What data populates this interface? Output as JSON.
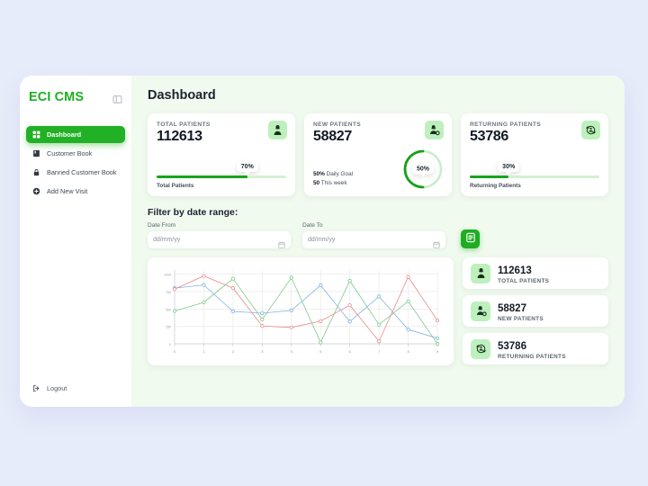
{
  "sidebar": {
    "brand": "ECI CMS",
    "collapse_icon": "panel-collapse-icon",
    "items": [
      {
        "label": "Dashboard",
        "icon": "grid-icon",
        "active": true
      },
      {
        "label": "Customer Book",
        "icon": "book-icon",
        "active": false
      },
      {
        "label": "Banned Customer Book",
        "icon": "lock-icon",
        "active": false
      },
      {
        "label": "Add New Visit",
        "icon": "plus-circle-icon",
        "active": false
      }
    ],
    "logout": {
      "label": "Logout",
      "icon": "logout-icon"
    }
  },
  "header": {
    "title": "Dashboard"
  },
  "stat_cards": [
    {
      "label": "TOTAL PATIENTS",
      "value": "112613",
      "icon": "patient-icon",
      "progress_label": "70%",
      "progress_pct": 70,
      "caption": "Total Patients",
      "type": "bar"
    },
    {
      "label": "NEW PATIENTS",
      "value": "58827",
      "icon": "new-patient-icon",
      "progress_label": "50%",
      "progress_pct": 50,
      "goal_value": "50%",
      "goal_text": "Daily Goal",
      "week_value": "50",
      "week_text": "This week",
      "type": "donut"
    },
    {
      "label": "RETURNING PATIENTS",
      "value": "53786",
      "icon": "returning-patient-icon",
      "progress_label": "30%",
      "progress_pct": 30,
      "caption": "Returning Patients",
      "type": "bar"
    }
  ],
  "filter": {
    "title": "Filter by date range:",
    "date_from": {
      "label": "Date From",
      "placeholder": "dd/mm/yy",
      "value": "",
      "icon": "calendar-icon"
    },
    "date_to": {
      "label": "Date To",
      "placeholder": "dd/mm/yy",
      "value": "",
      "icon": "calendar-icon"
    },
    "apply_button": {
      "icon": "report-icon",
      "label": ""
    }
  },
  "summary_list": [
    {
      "value": "112613",
      "label": "TOTAL PATIENTS",
      "icon": "patient-icon"
    },
    {
      "value": "58827",
      "label": "NEW PATIENTS",
      "icon": "new-patient-icon"
    },
    {
      "value": "53786",
      "label": "RETURNING PATIENTS",
      "icon": "returning-patient-icon"
    }
  ],
  "colors": {
    "accent_green": "#1db021",
    "icon_badge_green": "#bdf0bd",
    "page_bg": "#e7ecfa",
    "main_bg": "#f0faef",
    "series_blue": "#7fb2e5",
    "series_green": "#7ec98a",
    "series_red": "#e98b8b"
  },
  "chart_data": {
    "type": "line",
    "title": "",
    "xlabel": "",
    "ylabel": "",
    "x": [
      0,
      1,
      2,
      3,
      4,
      5,
      6,
      7,
      8,
      9
    ],
    "xticklabels": [
      "0",
      "1",
      "2",
      "3",
      "4",
      "5",
      "6",
      "7",
      "8",
      "9"
    ],
    "yticks": [
      0,
      250,
      500,
      750,
      1000
    ],
    "yticklabels": [
      "0",
      "250",
      "500",
      "750",
      "1000"
    ],
    "ylim": [
      0,
      1060
    ],
    "grid": true,
    "legend": "none",
    "markers": "open-circle",
    "series": [
      {
        "name": "series-blue",
        "color": "#7fb2e5",
        "values": [
          800,
          845,
          465,
          440,
          480,
          840,
          320,
          680,
          205,
          80
        ]
      },
      {
        "name": "series-green",
        "color": "#7ec98a",
        "values": [
          470,
          595,
          935,
          350,
          950,
          20,
          905,
          275,
          610,
          0
        ]
      },
      {
        "name": "series-red",
        "color": "#e98b8b",
        "values": [
          785,
          975,
          800,
          255,
          235,
          325,
          555,
          35,
          960,
          335
        ]
      }
    ]
  }
}
